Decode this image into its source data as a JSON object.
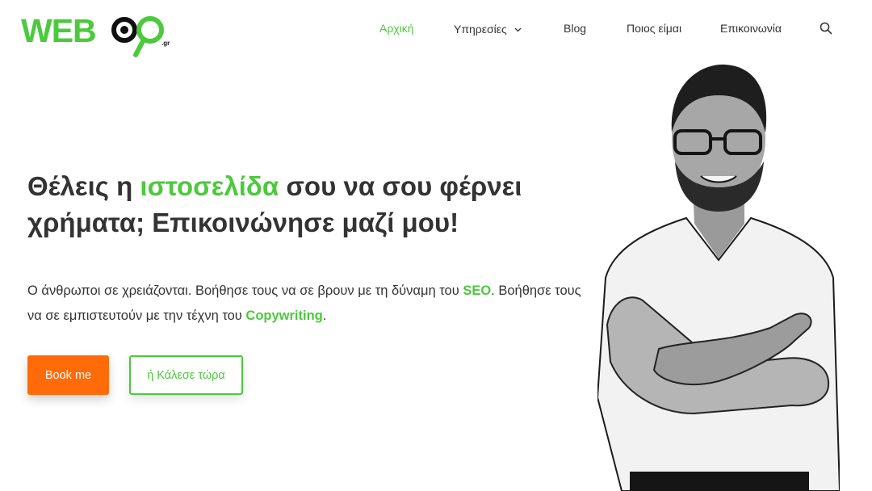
{
  "brand": {
    "logo_text": "WEBOO",
    "logo_tld": ".gr"
  },
  "nav": {
    "items": [
      {
        "label": "Αρχική"
      },
      {
        "label": "Υπηρεσίες"
      },
      {
        "label": "Blog"
      },
      {
        "label": "Ποιος είμαι"
      },
      {
        "label": "Επικοινωνία"
      }
    ],
    "active_index": 0,
    "search_icon": "search-icon",
    "dropdown_icon": "chevron-down-icon"
  },
  "hero": {
    "title_part1": "Θέλεις η ",
    "title_accent": "ιστοσελίδα",
    "title_part2": " σου να σου φέρνει χρήματα; Επικοινώνησε μαζί μου!",
    "text_part1": "Ο άνθρωποι σε χρειάζονται. Βοήθησε τους να σε βρουν με τη δύναμη του ",
    "text_accent1": "SEO",
    "text_part2": ". Βοήθησε τους να σε εμπιστευτούν με την τέχνη του ",
    "text_accent2": "Copywriting",
    "text_part3": ".",
    "primary_button": "Book me",
    "secondary_button": "ή Κάλεσε τώρα"
  },
  "colors": {
    "accent_green": "#4cc93d",
    "cta_orange": "#ff6b08",
    "text_dark": "#333333",
    "background": "#ffffff"
  }
}
